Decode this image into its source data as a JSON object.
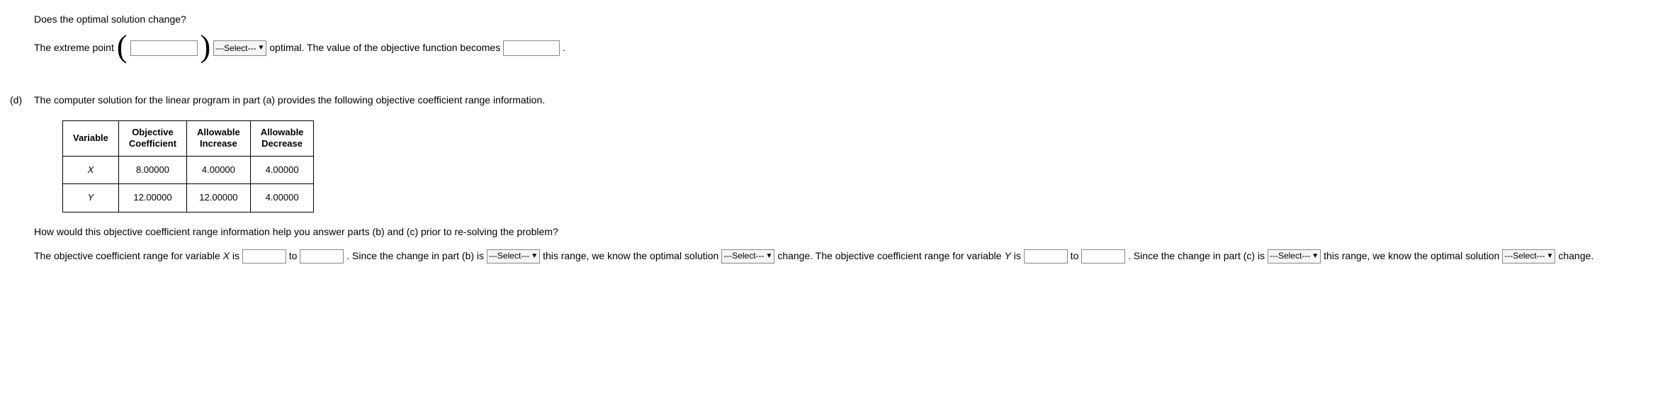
{
  "q1": {
    "prompt": "Does the optimal solution change?",
    "line_prefix": "The extreme point",
    "select_placeholder": "---Select---",
    "line_mid": "optimal. The value of the objective function becomes",
    "period": "."
  },
  "partD": {
    "label": "(d)",
    "intro": "The computer solution for the linear program in part (a) provides the following objective coefficient range information.",
    "table": {
      "headers": {
        "variable": "Variable",
        "objcoef1": "Objective",
        "objcoef2": "Coefficient",
        "allowinc1": "Allowable",
        "allowinc2": "Increase",
        "allowdec1": "Allowable",
        "allowdec2": "Decrease"
      },
      "rows": [
        {
          "variable": "X",
          "objcoef": "8.00000",
          "allowinc": "4.00000",
          "allowdec": "4.00000"
        },
        {
          "variable": "Y",
          "objcoef": "12.00000",
          "allowinc": "12.00000",
          "allowdec": "4.00000"
        }
      ]
    },
    "q2": "How would this objective coefficient range information help you answer parts (b) and (c) prior to re-solving the problem?",
    "flow": {
      "t1": "The objective coefficient range for variable ",
      "Xvar": "X",
      "t2": " is",
      "to": "to",
      "t3": ". Since the change in part (b) is",
      "select_placeholder": "---Select---",
      "t4": "this range, we know the optimal solution",
      "t5": "change. The objective coefficient range for variable ",
      "Yvar": "Y",
      "t6": " is",
      "t7": ". Since the change in part (c) is",
      "t8": "this range, we know the optimal solution",
      "t9": "change."
    }
  },
  "chart_data": {
    "type": "table",
    "headers": [
      "Variable",
      "Objective Coefficient",
      "Allowable Increase",
      "Allowable Decrease"
    ],
    "rows": [
      [
        "X",
        8.0,
        4.0,
        4.0
      ],
      [
        "Y",
        12.0,
        12.0,
        4.0
      ]
    ]
  }
}
